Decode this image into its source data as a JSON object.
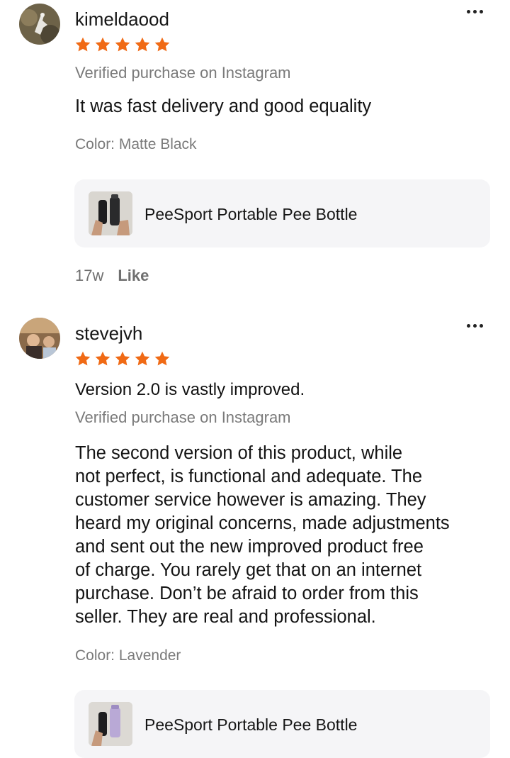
{
  "reviews": [
    {
      "username": "kimeldaood",
      "rating": 5,
      "title": "",
      "verified": "Verified purchase on Instagram",
      "body": "It was fast delivery and good equality",
      "color": "Color: Matte Black",
      "product_name": "PeeSport Portable Pee Bottle",
      "time_ago": "17w",
      "like_label": "Like"
    },
    {
      "username": "stevejvh",
      "rating": 5,
      "title": "Version 2.0 is vastly improved.",
      "verified": "Verified purchase on Instagram",
      "body": "The second version of this product, while\nnot perfect, is functional and adequate. The\ncustomer service however is amazing. They\nheard my original concerns, made adjustments\nand sent out the new improved product free\nof charge. You rarely get that on an internet\npurchase. Don’t be afraid to order from this\nseller. They are real and professional.",
      "color": "Color: Lavender",
      "product_name": "PeeSport Portable Pee Bottle"
    }
  ],
  "icons": {
    "more": "more-horizontal-icon",
    "star": "star-icon"
  },
  "colors": {
    "star": "#f06a15",
    "card_bg": "#f5f5f7",
    "secondary_text": "#7a7a7a"
  }
}
